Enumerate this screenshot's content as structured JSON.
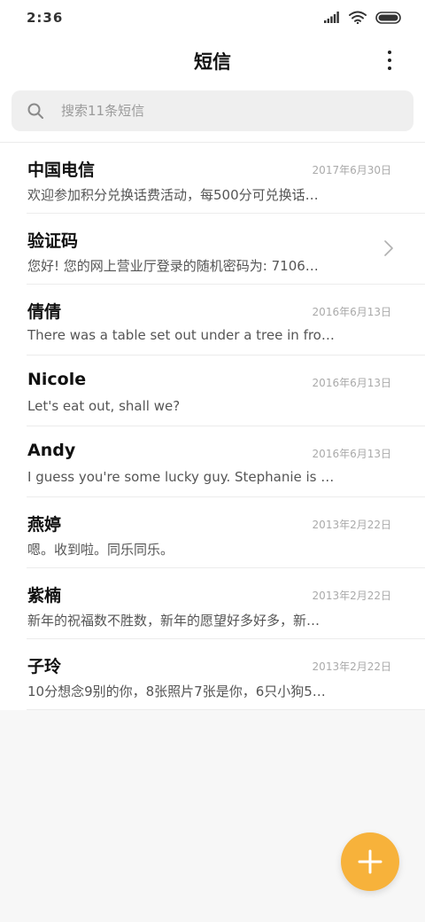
{
  "status_bar": {
    "time": "2:36"
  },
  "header": {
    "title": "短信"
  },
  "search": {
    "placeholder": "搜索11条短信"
  },
  "messages": [
    {
      "sender": "中国电信",
      "date": "2017年6月30日",
      "preview": "欢迎参加积分兑换话费活动，每500分可兑换话…"
    },
    {
      "sender": "验证码",
      "date": "",
      "preview": "您好! 您的网上营业厅登录的随机密码为: 7106…"
    },
    {
      "sender": "倩倩",
      "date": "2016年6月13日",
      "preview": "There was a table set out under a tree in fro…"
    },
    {
      "sender": "Nicole",
      "date": "2016年6月13日",
      "preview": "Let's eat out, shall we?"
    },
    {
      "sender": "Andy",
      "date": "2016年6月13日",
      "preview": "I guess you're some lucky guy. Stephanie is …"
    },
    {
      "sender": "燕婷",
      "date": "2013年2月22日",
      "preview": "嗯。收到啦。同乐同乐。"
    },
    {
      "sender": "紫楠",
      "date": "2013年2月22日",
      "preview": "新年的祝福数不胜数，新年的愿望好多好多，新…"
    },
    {
      "sender": "子玲",
      "date": "2013年2月22日",
      "preview": "10分想念9别的你，8张照片7张是你，6只小狗5…"
    }
  ],
  "colors": {
    "accent": "#f7b23b",
    "background": "#f7f7f7",
    "surface": "#ffffff",
    "search_bg": "#efefef"
  },
  "icons": {
    "search": "search-icon",
    "more": "more-vertical-icon",
    "chevron": "chevron-right-icon",
    "fab": "plus-icon",
    "signal": "signal-icon",
    "wifi": "wifi-icon",
    "battery": "battery-icon"
  }
}
